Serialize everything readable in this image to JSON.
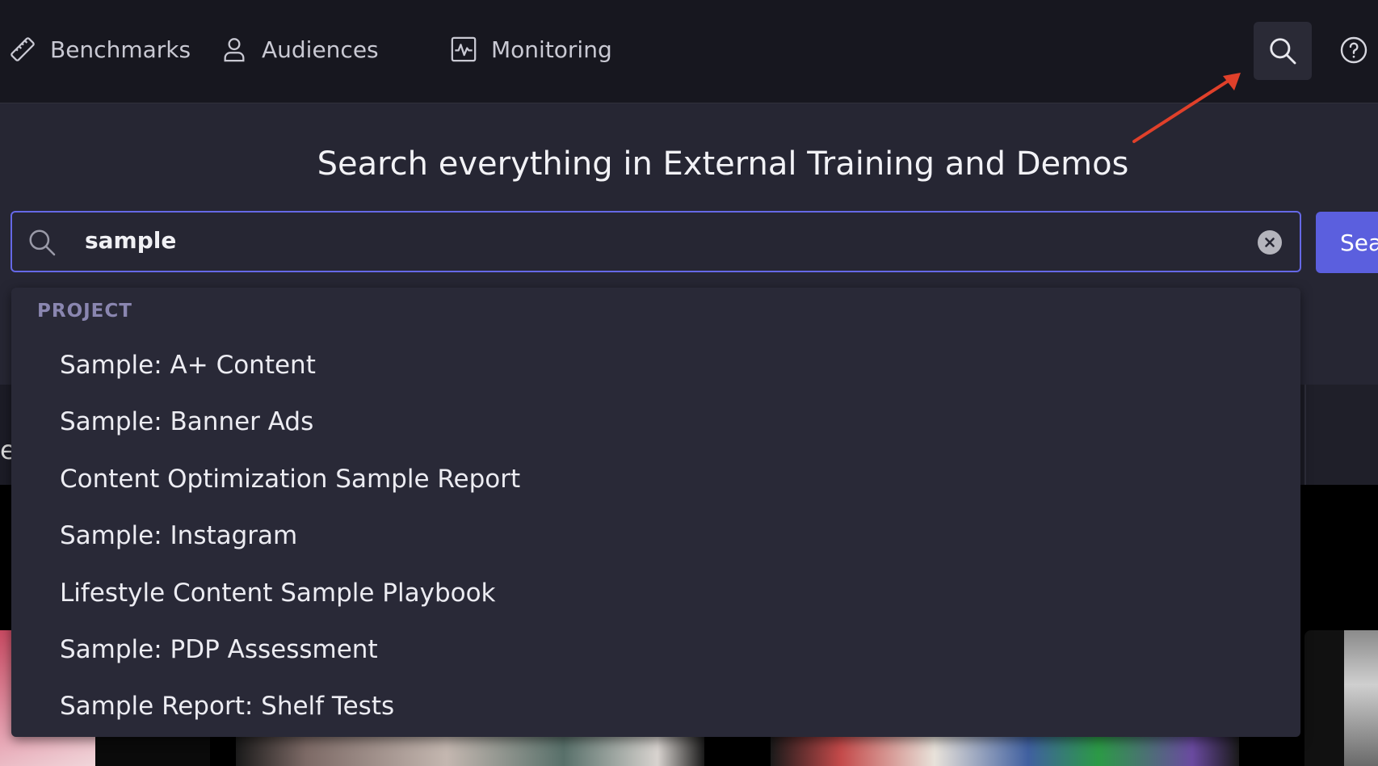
{
  "nav": {
    "items": [
      {
        "label": "Benchmarks",
        "icon": "ruler-icon"
      },
      {
        "label": "Audiences",
        "icon": "person-icon"
      },
      {
        "label": "Monitoring",
        "icon": "activity-chart-icon"
      }
    ]
  },
  "header": {
    "search_icon": "search-icon",
    "help_icon": "help-icon"
  },
  "search": {
    "heading": "Search everything in External Training and Demos",
    "query": "sample",
    "submit_label": "Sea"
  },
  "dropdown": {
    "section_label": "PROJECT",
    "results": [
      "Sample: A+ Content",
      "Sample: Banner Ads",
      "Content Optimization Sample Report",
      "Sample: Instagram",
      "Lifestyle Content Sample Playbook",
      "Sample: PDP Assessment",
      "Sample Report: Shelf Tests"
    ]
  },
  "background": {
    "partial_letter": "e"
  },
  "colors": {
    "accent": "#5b5fde",
    "annotation_arrow": "#e0402a",
    "topbar": "#17171f",
    "dropdown": "#292937"
  }
}
